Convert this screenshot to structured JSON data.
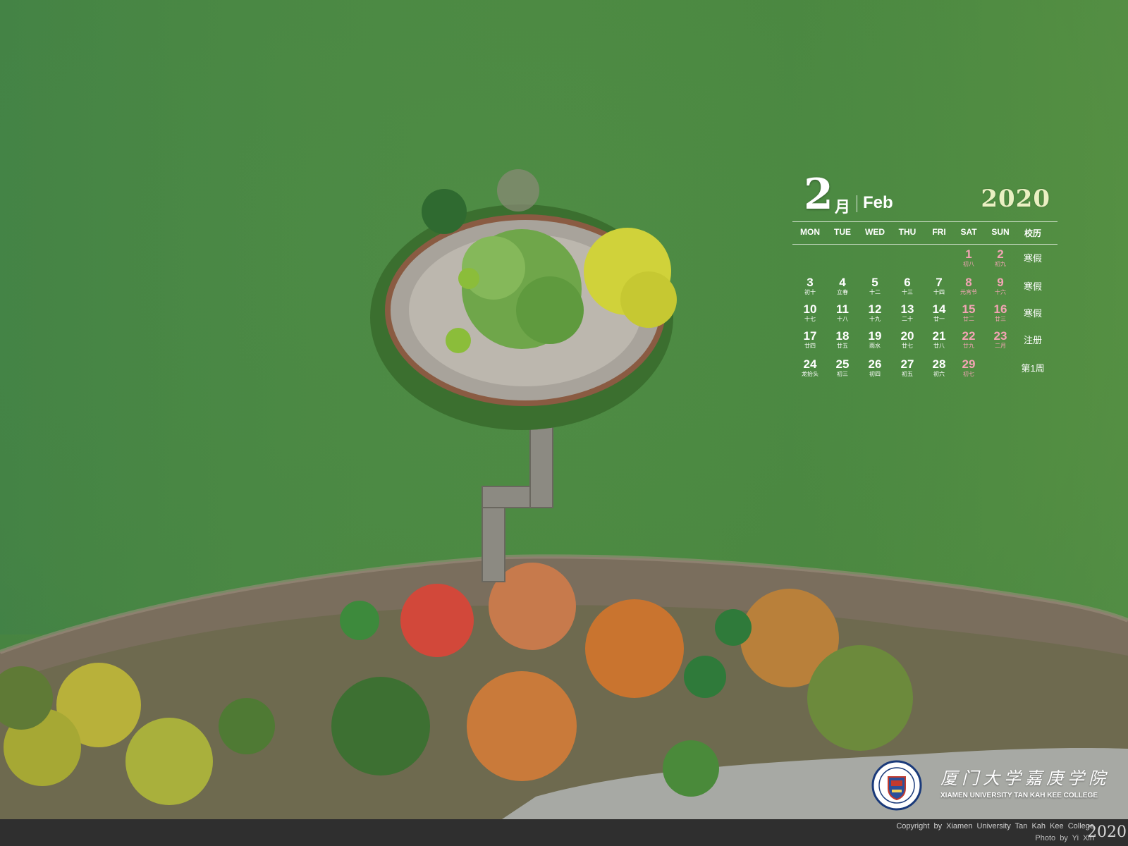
{
  "calendar": {
    "month_number": "2",
    "month_cn": "月",
    "month_en": "Feb",
    "year": "2020",
    "headers": [
      "MON",
      "TUE",
      "WED",
      "THU",
      "FRI",
      "SAT",
      "SUN",
      "校历"
    ],
    "weeks": [
      {
        "days": [
          null,
          null,
          null,
          null,
          null,
          {
            "n": "1",
            "l": "初八"
          },
          {
            "n": "2",
            "l": "初九"
          }
        ],
        "note": "寒假"
      },
      {
        "days": [
          {
            "n": "3",
            "l": "初十"
          },
          {
            "n": "4",
            "l": "立春"
          },
          {
            "n": "5",
            "l": "十二"
          },
          {
            "n": "6",
            "l": "十三"
          },
          {
            "n": "7",
            "l": "十四"
          },
          {
            "n": "8",
            "l": "元宵节"
          },
          {
            "n": "9",
            "l": "十六"
          }
        ],
        "note": "寒假"
      },
      {
        "days": [
          {
            "n": "10",
            "l": "十七"
          },
          {
            "n": "11",
            "l": "十八"
          },
          {
            "n": "12",
            "l": "十九"
          },
          {
            "n": "13",
            "l": "二十"
          },
          {
            "n": "14",
            "l": "廿一"
          },
          {
            "n": "15",
            "l": "廿二"
          },
          {
            "n": "16",
            "l": "廿三"
          }
        ],
        "note": "寒假"
      },
      {
        "days": [
          {
            "n": "17",
            "l": "廿四"
          },
          {
            "n": "18",
            "l": "廿五"
          },
          {
            "n": "19",
            "l": "雨水"
          },
          {
            "n": "20",
            "l": "廿七"
          },
          {
            "n": "21",
            "l": "廿八"
          },
          {
            "n": "22",
            "l": "廿九"
          },
          {
            "n": "23",
            "l": "二月"
          }
        ],
        "note": "注册"
      },
      {
        "days": [
          {
            "n": "24",
            "l": "龙抬头"
          },
          {
            "n": "25",
            "l": "初三"
          },
          {
            "n": "26",
            "l": "初四"
          },
          {
            "n": "27",
            "l": "初五"
          },
          {
            "n": "28",
            "l": "初六"
          },
          {
            "n": "29",
            "l": "初七"
          },
          null
        ],
        "note": "第1周"
      }
    ],
    "weekend_color": "#f3a4b4",
    "year_color": "#eaf0c2"
  },
  "branding": {
    "name_cn": "厦门大学嘉庚学院",
    "name_en": "XIAMEN UNIVERSITY TAN KAH KEE COLLEGE",
    "logo_icon": "college-seal-icon"
  },
  "footer": {
    "copyright": "Copyright by Xiamen University Tan Kah Kee College",
    "photo_credit": "Photo by Yi Xin",
    "year": "2020"
  },
  "colors": {
    "water": "#4f8a45",
    "footer_bg": "#2f2f2f"
  }
}
